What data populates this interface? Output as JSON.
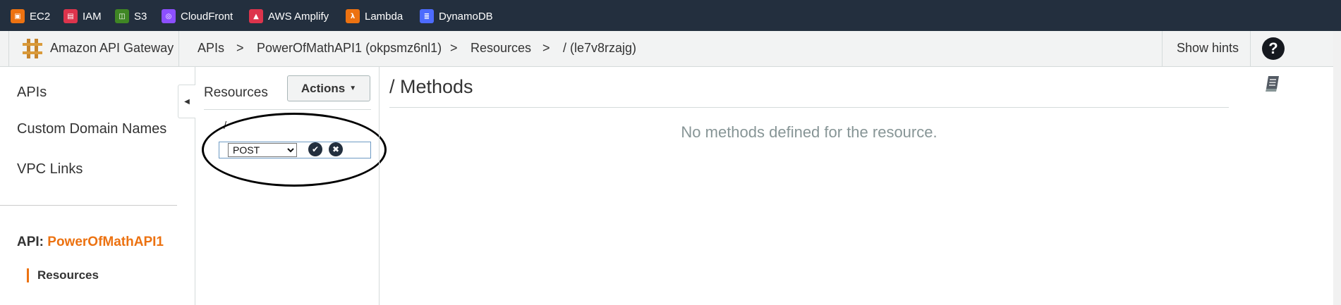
{
  "services": [
    {
      "label": "EC2",
      "icon": "ec2-icon",
      "color": "#ec7211"
    },
    {
      "label": "IAM",
      "icon": "iam-icon",
      "color": "#dd344c"
    },
    {
      "label": "S3",
      "icon": "s3-icon",
      "color": "#3f8624"
    },
    {
      "label": "CloudFront",
      "icon": "cloudfront-icon",
      "color": "#8c4fff"
    },
    {
      "label": "AWS Amplify",
      "icon": "amplify-icon",
      "color": "#dd344c"
    },
    {
      "label": "Lambda",
      "icon": "lambda-icon",
      "color": "#ec7211"
    },
    {
      "label": "DynamoDB",
      "icon": "dynamodb-icon",
      "color": "#4d6bfe"
    }
  ],
  "header": {
    "title": "Amazon API Gateway",
    "breadcrumbs": [
      "APIs",
      "PowerOfMathAPI1 (okpsmz6nl1)",
      "Resources",
      "/ (le7v8rzajg)"
    ],
    "separator": ">",
    "hints": "Show hints",
    "help": "?"
  },
  "sidebar": {
    "items": [
      "APIs",
      "Custom Domain Names",
      "VPC Links"
    ],
    "api_prefix": "API:",
    "api_name": "PowerOfMathAPI1",
    "sub_item": "Resources"
  },
  "resources": {
    "title": "Resources",
    "actions": "Actions",
    "root": "/",
    "method_options": [
      "POST"
    ],
    "method_selected": "POST"
  },
  "methods": {
    "title": "/ Methods",
    "empty": "No methods defined for the resource."
  }
}
